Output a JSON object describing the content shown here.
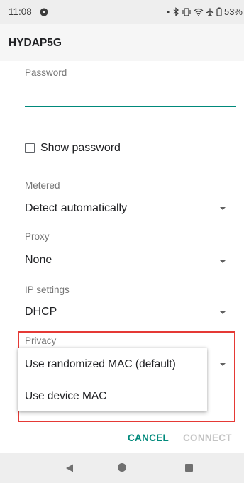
{
  "status_bar": {
    "time": "11:08",
    "battery_percent": "53%",
    "icons": [
      "notification-icon",
      "dot-icon",
      "bluetooth-icon",
      "vibrate-icon",
      "wifi-icon",
      "airplane-icon",
      "battery-icon"
    ]
  },
  "dialog": {
    "title": "HYDAP5G"
  },
  "form": {
    "password_label": "Password",
    "password_value": "",
    "show_password_label": "Show password",
    "show_password_checked": false,
    "metered_label": "Metered",
    "metered_value": "Detect automatically",
    "proxy_label": "Proxy",
    "proxy_value": "None",
    "ip_settings_label": "IP settings",
    "ip_settings_value": "DHCP",
    "privacy_label": "Privacy"
  },
  "privacy_dropdown": {
    "options": [
      "Use randomized MAC (default)",
      "Use device MAC"
    ]
  },
  "actions": {
    "cancel_label": "CANCEL",
    "connect_label": "CONNECT"
  },
  "colors": {
    "accent": "#00897b",
    "highlight": "#e53935",
    "disabled": "#c4c4c4"
  }
}
